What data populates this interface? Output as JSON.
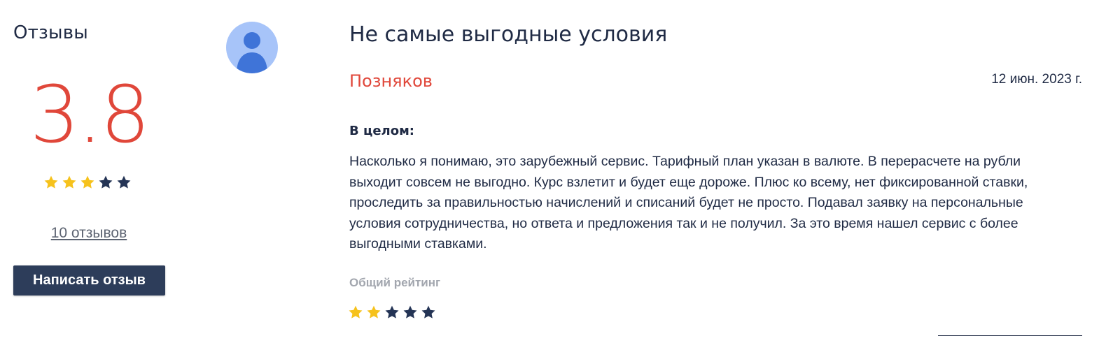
{
  "sidebar": {
    "title": "Отзывы",
    "score": "3.8",
    "score_color": "#e0473a",
    "stars": [
      {
        "state": "on"
      },
      {
        "state": "on"
      },
      {
        "state": "on"
      },
      {
        "state": "off"
      },
      {
        "state": "off"
      }
    ],
    "rating_stars_filled": 3,
    "rating_stars_total": 5,
    "reviews_link": "10 отзывов",
    "write_button": "Написать отзыв",
    "button_color": "#2d3d5a"
  },
  "review": {
    "avatar_icon": "user-avatar-icon",
    "title": "Не самые выгодные условия",
    "author": "Позняков",
    "date": "12 июн. 2023 г.",
    "section_label": "В целом:",
    "body": "Насколько я понимаю, это зарубежный сервис. Тарифный план указан в валюте. В перерасчете на рубли выходит совсем не выгодно. Курс взлетит и будет еще дороже. Плюс ко всему, нет фиксированной ставки, проследить за правильностью начислений и списаний будет не просто. Подавал заявку на персональные условия сотрудничества, но ответа и предложения так и не получил. За это время нашел сервис с более выгодными ставками.",
    "rating_label": "Общий рейтинг",
    "rating_stars_filled": 2,
    "rating_stars_total": 5
  },
  "colors": {
    "star_filled": "#f6c21c",
    "star_empty": "#243455",
    "accent": "#e0473a",
    "text": "#1f2a44"
  }
}
